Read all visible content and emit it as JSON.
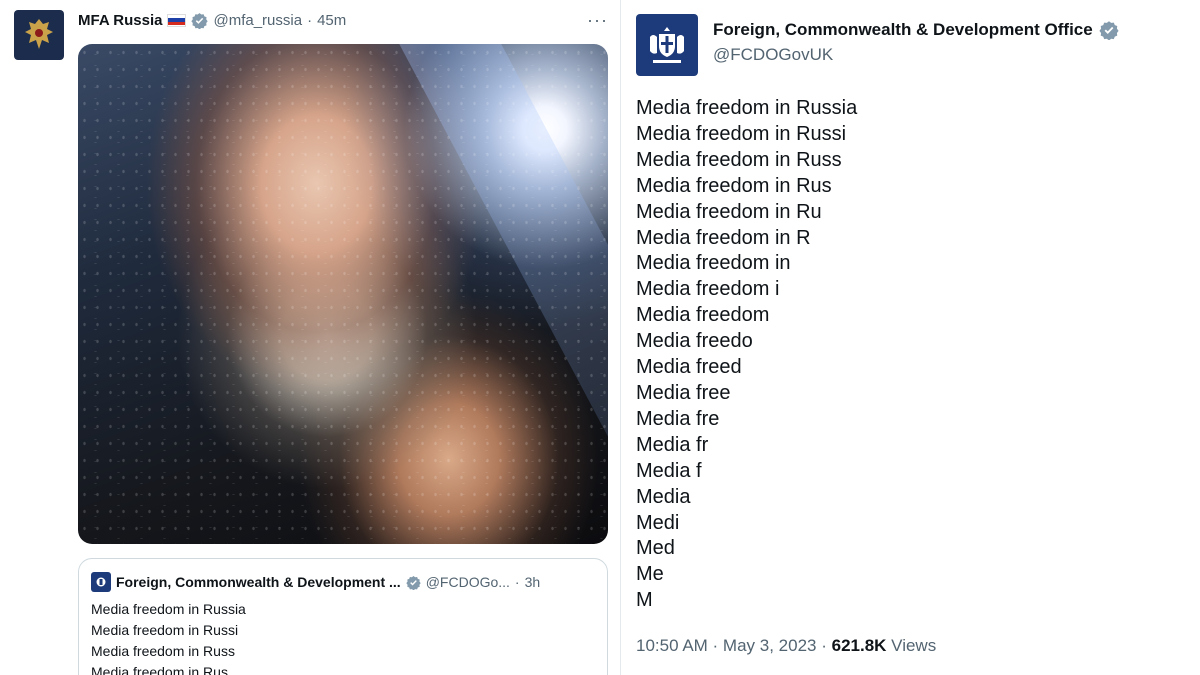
{
  "left_tweet": {
    "name": "MFA Russia",
    "handle": "@mfa_russia",
    "separator": "·",
    "time": "45m",
    "more": "···",
    "quoted": {
      "name": "Foreign, Commonwealth & Development ...",
      "handle": "@FCDOGo...",
      "separator": "·",
      "time": "3h",
      "lines": [
        "Media freedom in Russia",
        "Media freedom in Russi",
        "Media freedom in Russ",
        "Media freedom in Rus"
      ]
    }
  },
  "right_tweet": {
    "name": "Foreign, Commonwealth & Development Office",
    "handle": "@FCDOGovUK",
    "lines": [
      "Media freedom in Russia",
      "Media freedom in Russi",
      "Media freedom in Russ",
      "Media freedom in Rus",
      "Media freedom in Ru",
      "Media freedom in R",
      "Media freedom in",
      "Media freedom i",
      "Media freedom",
      "Media freedo",
      "Media freed",
      "Media free",
      "Media fre",
      "Media fr",
      "Media f",
      "Media",
      "Medi",
      "Med",
      "Me",
      "M"
    ],
    "timestamp": "10:50 AM · May 3, 2023 · ",
    "views_count": "621.8K",
    "views_label": " Views"
  },
  "colors": {
    "verified": "#829aab",
    "handle_gray": "#536471",
    "fcdo_blue": "#1d3a7a",
    "mfa_navy": "#1c2c4c"
  },
  "icons": {
    "verified": "verified-badge-icon",
    "flag": "russia-flag-icon",
    "mfa_avatar": "russian-coat-of-arms-icon",
    "fcdo_avatar": "royal-coat-of-arms-icon",
    "more": "more-options-icon"
  }
}
